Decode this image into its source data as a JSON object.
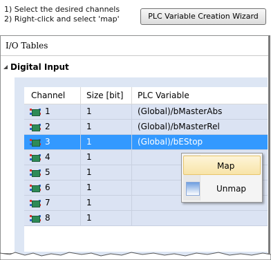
{
  "instructions": {
    "line1": "1) Select the desired channels",
    "line2": "2) Right-click and select 'map'"
  },
  "wizard_button_label": "PLC Variable Creation Wizard",
  "panel": {
    "title": "I/O Tables",
    "section": "Digital Input"
  },
  "table": {
    "columns": [
      "Channel",
      "Size [bit]",
      "PLC Variable"
    ],
    "rows": [
      {
        "channel": "1",
        "size": "1",
        "variable": "(Global)/bMasterAbs",
        "selected": false
      },
      {
        "channel": "2",
        "size": "1",
        "variable": "(Global)/bMasterRel",
        "selected": false
      },
      {
        "channel": "3",
        "size": "1",
        "variable": "(Global)/bEStop",
        "selected": true
      },
      {
        "channel": "4",
        "size": "1",
        "variable": "",
        "selected": false
      },
      {
        "channel": "5",
        "size": "1",
        "variable": "",
        "selected": false
      },
      {
        "channel": "6",
        "size": "1",
        "variable": "",
        "selected": false
      },
      {
        "channel": "7",
        "size": "1",
        "variable": "",
        "selected": false
      },
      {
        "channel": "8",
        "size": "1",
        "variable": "",
        "selected": false
      }
    ]
  },
  "context_menu": {
    "map": "Map",
    "unmap": "Unmap"
  },
  "colors": {
    "selection": "#3399ff",
    "row_bg": "#dbe3f3",
    "menu_hover": "#f8e4a8"
  }
}
